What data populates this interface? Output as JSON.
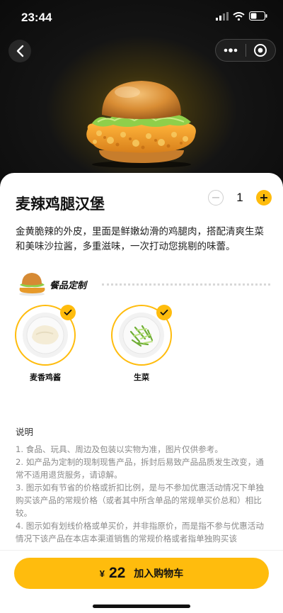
{
  "status_bar": {
    "time": "23:44"
  },
  "product": {
    "name": "麦辣鸡腿汉堡",
    "quantity": "1",
    "description": "金黄脆辣的外皮，里面是鲜嫩幼滑的鸡腿肉，搭配清爽生菜和美味沙拉酱，多重滋味，一次打动您挑剔的味蕾。"
  },
  "customization": {
    "title": "餐品定制",
    "options": [
      {
        "label": "麦香鸡酱",
        "checked": true
      },
      {
        "label": "生菜",
        "checked": true
      }
    ]
  },
  "notes": {
    "title": "说明",
    "items": [
      "1. 食品、玩具、周边及包装以实物为准，图片仅供参考。",
      "2. 如产品为定制的现制现售产品，拆封后易致产品品质发生改变，通常不适用退货服务，请谅解。",
      "3. 图示如有节省的价格或折扣比例，是与不参加优惠活动情况下单独购买该产品的常规价格（或者其中所含单品的常规单买价总和）相比较。",
      "4. 图示如有划线价格或单买价，并非指原价，而是指不参与优惠活动情况下该产品在本店本渠道销售的常规价格或者指单独购买该"
    ]
  },
  "cart": {
    "currency_symbol": "¥",
    "price": "22",
    "label": "加入购物车"
  },
  "colors": {
    "accent": "#ffbc0d",
    "text": "#111111",
    "muted": "#8a8a8a"
  },
  "icons": {
    "back": "back-arrow-icon",
    "more": "more-dots-icon",
    "close": "target-close-icon",
    "minus": "minus-icon",
    "plus": "plus-icon",
    "check": "checkmark-icon"
  }
}
